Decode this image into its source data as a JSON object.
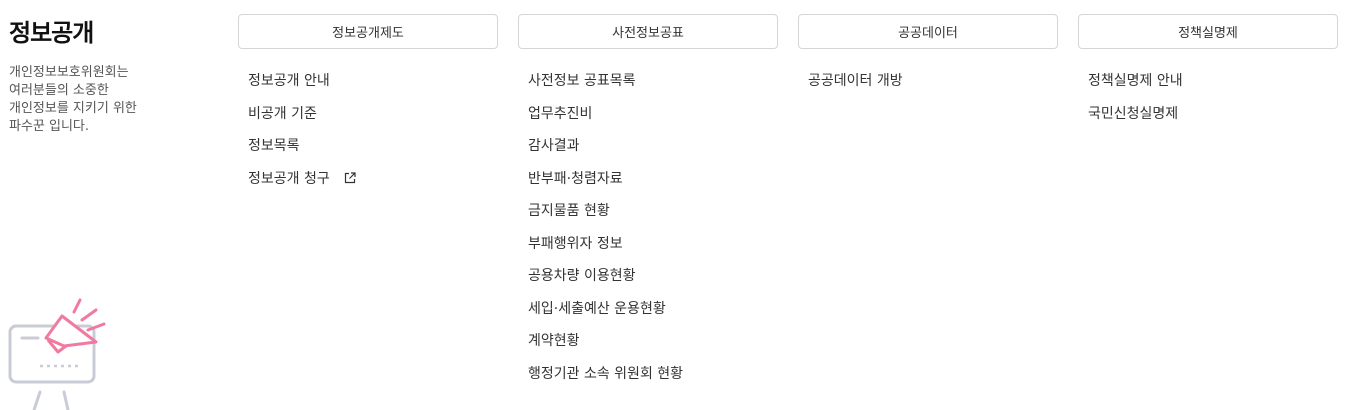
{
  "intro": {
    "title": "정보공개",
    "desc": "개인정보보호위원회는 여러분들의 소중한 개인정보를 지키기 위한 파수꾼 입니다."
  },
  "columns": [
    {
      "heading": "정보공개제도",
      "items": [
        {
          "label": "정보공개 안내"
        },
        {
          "label": "비공개 기준"
        },
        {
          "label": "정보목록"
        },
        {
          "label": "정보공개 청구",
          "icon": "external-link-icon"
        }
      ]
    },
    {
      "heading": "사전정보공표",
      "items": [
        {
          "label": "사전정보 공표목록"
        },
        {
          "label": "업무추진비"
        },
        {
          "label": "감사결과"
        },
        {
          "label": "반부패·청렴자료"
        },
        {
          "label": "금지물품 현황"
        },
        {
          "label": "부패행위자 정보"
        },
        {
          "label": "공용차량 이용현황"
        },
        {
          "label": "세입·세출예산 운용현황"
        },
        {
          "label": "계약현황"
        },
        {
          "label": "행정기관 소속 위원회 현황"
        }
      ]
    },
    {
      "heading": "공공데이터",
      "items": [
        {
          "label": "공공데이터 개방"
        }
      ]
    },
    {
      "heading": "정책실명제",
      "items": [
        {
          "label": "정책실명제 안내"
        },
        {
          "label": "국민신청실명제"
        }
      ]
    }
  ],
  "colors": {
    "accent_pink": "#f07aa0",
    "illustration_gray": "#c9ccd6",
    "border": "#d6d6d6"
  },
  "illustration": "megaphone-monitor-illustration"
}
